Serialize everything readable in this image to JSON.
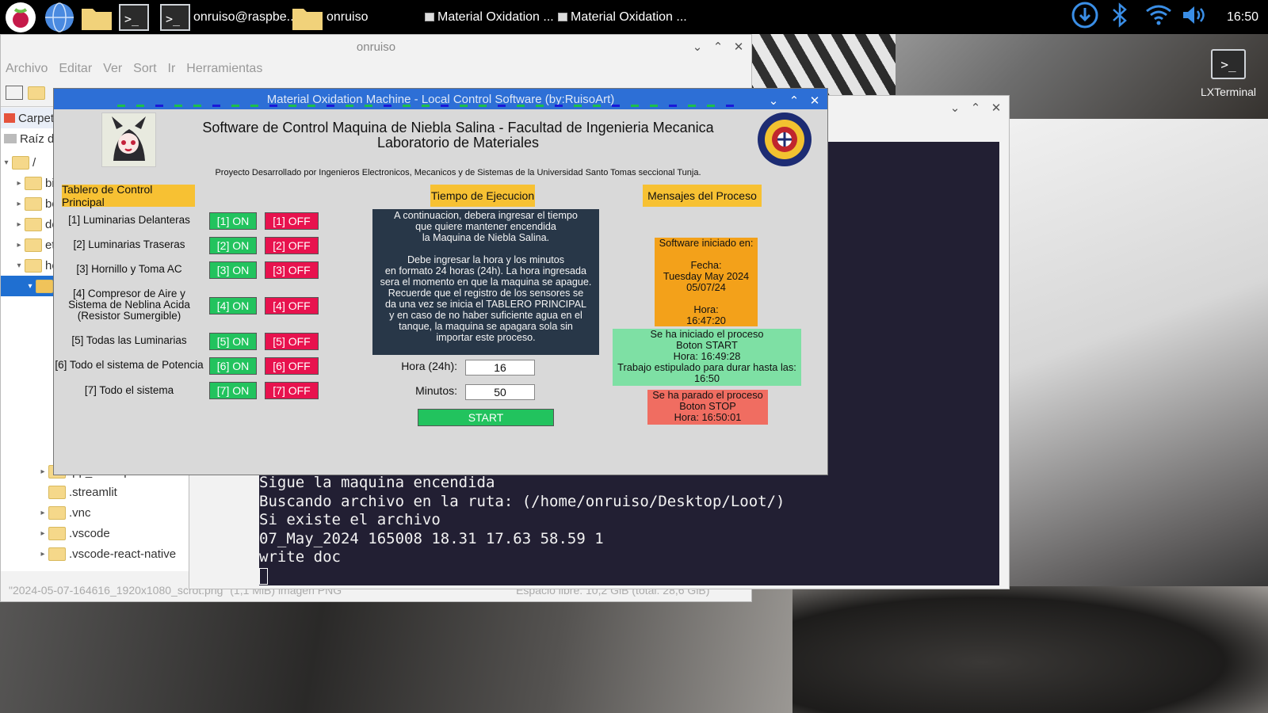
{
  "taskbar": {
    "apps": [
      {
        "label": "onruiso@raspbe...",
        "icon": "terminal-icon"
      },
      {
        "label": "onruiso",
        "icon": "folder-icon"
      },
      {
        "label": "Material Oxidation ...",
        "icon": "window-icon"
      },
      {
        "label": "Material Oxidation ...",
        "icon": "window-icon"
      }
    ],
    "clock": "16:50"
  },
  "file_manager": {
    "title": "onruiso",
    "menu": [
      "Archivo",
      "Editar",
      "Ver",
      "Sort",
      "Ir",
      "Herramientas"
    ],
    "sidebar_top": [
      "Carpet",
      "Raíz de"
    ],
    "tree": [
      {
        "label": "/"
      },
      {
        "label": "bi"
      },
      {
        "label": "bo"
      },
      {
        "label": "de"
      },
      {
        "label": "et"
      },
      {
        "label": "ho"
      },
      {
        "label": ""
      },
      {
        "label": ".pp_backup"
      },
      {
        "label": ".streamlit"
      },
      {
        "label": ".vnc"
      },
      {
        "label": ".vscode"
      },
      {
        "label": ".vscode-react-native"
      }
    ],
    "status_left": "\"2024-05-07-164616_1920x1080_scrot.png\" (1,1 MiB) imagen PNG",
    "status_right": "Espacio libre: 10,2 GiB (total: 28,6 GiB)"
  },
  "terminal": {
    "lines": [
      "Sigue la maquina encendida",
      "Buscando archivo en la ruta: (/home/onruiso/Desktop/Loot/)",
      "Si existe el archivo",
      "07_May_2024 165008 18.31 17.63 58.59 1",
      "write doc"
    ]
  },
  "desktop_icon": {
    "label": "LXTerminal"
  },
  "app": {
    "window_title": "Material Oxidation Machine - Local Control Software (by:RuisoArt)",
    "header_line1": "Software de Control Maquina de Niebla Salina - Facultad de Ingenieria Mecanica",
    "header_line2": "Laboratorio de Materiales",
    "subtitle": "Proyecto Desarrollado por Ingenieros Electronicos, Mecanicos y de Sistemas de la Universidad Santo Tomas seccional Tunja.",
    "sections": {
      "control": "Tablero de Control Principal",
      "time": "Tiempo de Ejecucion",
      "messages": "Mensajes del Proceso"
    },
    "controls": [
      {
        "label": "[1] Luminarias Delanteras",
        "on": "[1] ON",
        "off": "[1] OFF"
      },
      {
        "label": "[2] Luminarias Traseras",
        "on": "[2] ON",
        "off": "[2] OFF"
      },
      {
        "label": "[3] Hornillo y Toma AC",
        "on": "[3] ON",
        "off": "[3] OFF"
      },
      {
        "label": "[4] Compresor de Aire y Sistema de Neblina Acida (Resistor Sumergible)",
        "on": "[4] ON",
        "off": "[4] OFF"
      },
      {
        "label": "[5] Todas las Luminarias",
        "on": "[5] ON",
        "off": "[5] OFF"
      },
      {
        "label": "[6] Todo el sistema de Potencia",
        "on": "[6] ON",
        "off": "[6] OFF"
      },
      {
        "label": "[7] Todo el sistema",
        "on": "[7] ON",
        "off": "[7] OFF"
      }
    ],
    "instructions": "A continuacion, debera ingresar el tiempo\nque quiere mantener encendida\nla Maquina de Niebla Salina.\n\nDebe ingresar la hora y los minutos\nen formato 24 horas (24h). La hora ingresada\nsera el momento en que la maquina se apague.\nRecuerde que el registro de los sensores se\nda una vez se inicia el TABLERO PRINCIPAL\ny en caso de no haber suficiente agua en el\ntanque, la maquina se apagara sola sin\nimportar este proceso.",
    "hour_label": "Hora (24h):",
    "hour_value": "16",
    "minutes_label": "Minutos:",
    "minutes_value": "50",
    "start_label": "START",
    "msg_started": "Software iniciado en:\n\nFecha:\nTuesday May 2024\n05/07/24\n\nHora:\n16:47:20",
    "msg_process": "Se ha iniciado el proceso\nBoton START\nHora: 16:49:28\nTrabajo estipulado para durar hasta las:\n16:50",
    "msg_stop": "Se ha parado el proceso\nBoton STOP\nHora: 16:50:01"
  },
  "colors": {
    "title_bar": "#2d6fd6",
    "section": "#f7c133",
    "on": "#22c35e",
    "off": "#e8124e",
    "terminal_bg": "#221f33"
  }
}
